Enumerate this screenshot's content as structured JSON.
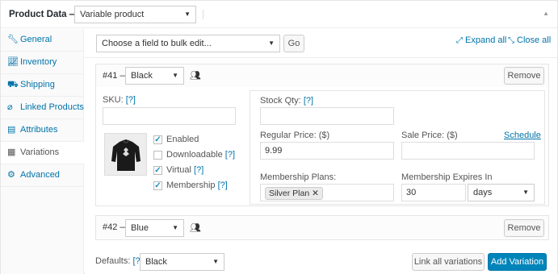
{
  "header": {
    "title": "Product Data —",
    "product_type": "Variable product"
  },
  "tabs": [
    {
      "label": "General",
      "icon": "wrench-icon"
    },
    {
      "label": "Inventory",
      "icon": "chart-icon"
    },
    {
      "label": "Shipping",
      "icon": "truck-icon"
    },
    {
      "label": "Linked Products",
      "icon": "link-icon"
    },
    {
      "label": "Attributes",
      "icon": "list-icon"
    },
    {
      "label": "Variations",
      "icon": "grid-icon"
    },
    {
      "label": "Advanced",
      "icon": "gear-icon"
    }
  ],
  "toolbar": {
    "bulk_placeholder": "Choose a field to bulk edit...",
    "go_label": "Go",
    "expand_all": "Expand all",
    "close_all": "Close all"
  },
  "variation1": {
    "id": "#41 —",
    "color": "Black",
    "remove": "Remove",
    "sku_label": "SKU:",
    "help": "[?]",
    "sku_value": "",
    "enabled": "Enabled",
    "downloadable": "Downloadable",
    "virtual": "Virtual",
    "membership": "Membership",
    "stock_label": "Stock Qty:",
    "stock_value": "",
    "regular_price_label": "Regular Price: ($)",
    "regular_price_value": "9.99",
    "sale_price_label": "Sale Price: ($)",
    "sale_price_value": "",
    "schedule": "Schedule",
    "plans_label": "Membership Plans:",
    "plan_tag": "Silver Plan",
    "expires_label": "Membership Expires In",
    "expires_value": "30",
    "expires_unit": "days"
  },
  "variation2": {
    "id": "#42 —",
    "color": "Blue",
    "remove": "Remove"
  },
  "footer": {
    "defaults_label": "Defaults:",
    "help": "[?]",
    "defaults_value": "Black",
    "link_all": "Link all variations",
    "add_variation": "Add Variation"
  }
}
